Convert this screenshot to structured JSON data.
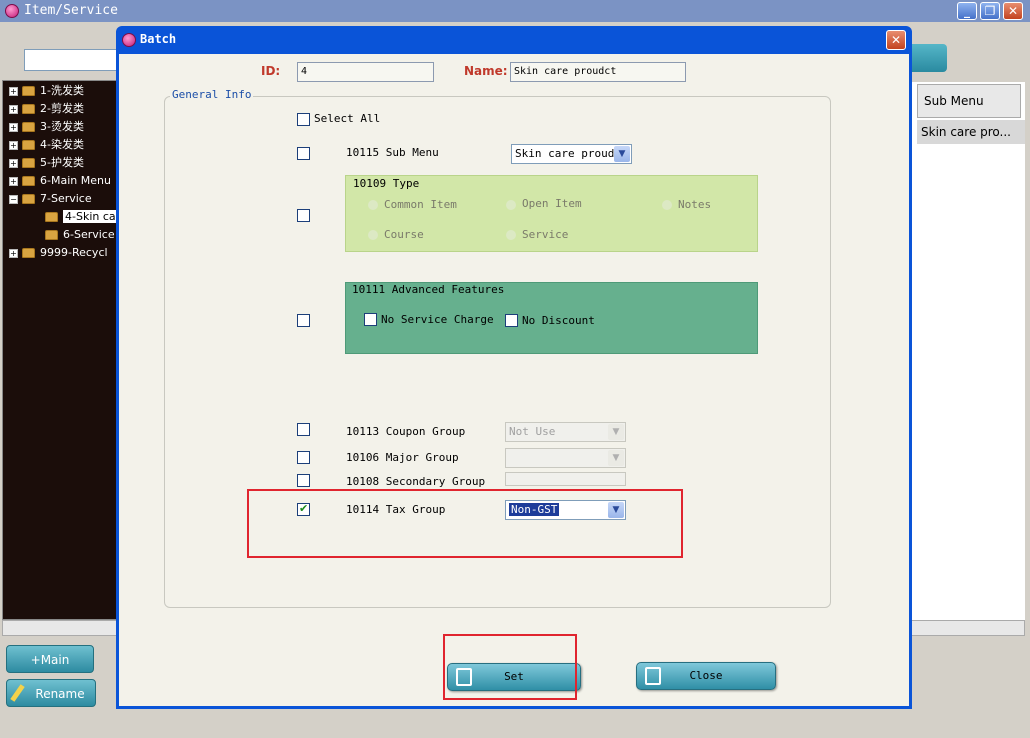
{
  "main": {
    "title": "Item/Service",
    "tree": [
      {
        "label": "1-洗发类",
        "expanded": false
      },
      {
        "label": "2-剪发类",
        "expanded": false
      },
      {
        "label": "3-烫发类",
        "expanded": false
      },
      {
        "label": "4-染发类",
        "expanded": false
      },
      {
        "label": "5-护发类",
        "expanded": false
      },
      {
        "label": "6-Main Menu",
        "expanded": false
      },
      {
        "label": "7-Service",
        "expanded": true
      },
      {
        "label": "4-Skin ca",
        "child": true,
        "selected": true
      },
      {
        "label": "6-Service",
        "child": true
      },
      {
        "label": "9999-Recycl",
        "expanded": false
      }
    ],
    "grid": {
      "header": "Sub Menu",
      "cell": "Skin care pro..."
    },
    "buttons": {
      "add_main": "+Main",
      "rename": "Rename"
    }
  },
  "dialog": {
    "title": "Batch",
    "id_label": "ID:",
    "id_value": "4",
    "name_label": "Name:",
    "name_value": "Skin care proudct",
    "group_legend": "General Info",
    "select_all": "Select All",
    "sub_menu": {
      "label": "10115 Sub Menu",
      "value": "Skin care proudc"
    },
    "type_panel": {
      "title": "10109 Type",
      "options": [
        "Common Item",
        "Open Item",
        "Notes",
        "Course",
        "Service"
      ]
    },
    "advanced_panel": {
      "title": "10111 Advanced Features",
      "options": [
        "No Service Charge",
        "No Discount"
      ]
    },
    "coupon_group": {
      "label": "10113 Coupon Group",
      "value": "Not Use"
    },
    "major_group": {
      "label": "10106 Major Group",
      "value": ""
    },
    "secondary_group": {
      "label": "10108 Secondary Group",
      "value": ""
    },
    "tax_group": {
      "label": "10114 Tax Group",
      "value": "Non-GST",
      "checked": true
    },
    "set_button": "Set",
    "close_button": "Close"
  },
  "colors": {
    "title_bar": "#0a54d8",
    "highlight_box": "#e0252f",
    "button_teal": "#2f8fa6",
    "type_panel": "#d2e7a8",
    "advanced_panel": "#66b08e"
  },
  "icons": [
    "app-icon",
    "minimize-icon",
    "restore-icon",
    "close-icon",
    "chevron-down-icon",
    "set-icon",
    "exit-icon",
    "folder-icon",
    "pencil-icon"
  ]
}
